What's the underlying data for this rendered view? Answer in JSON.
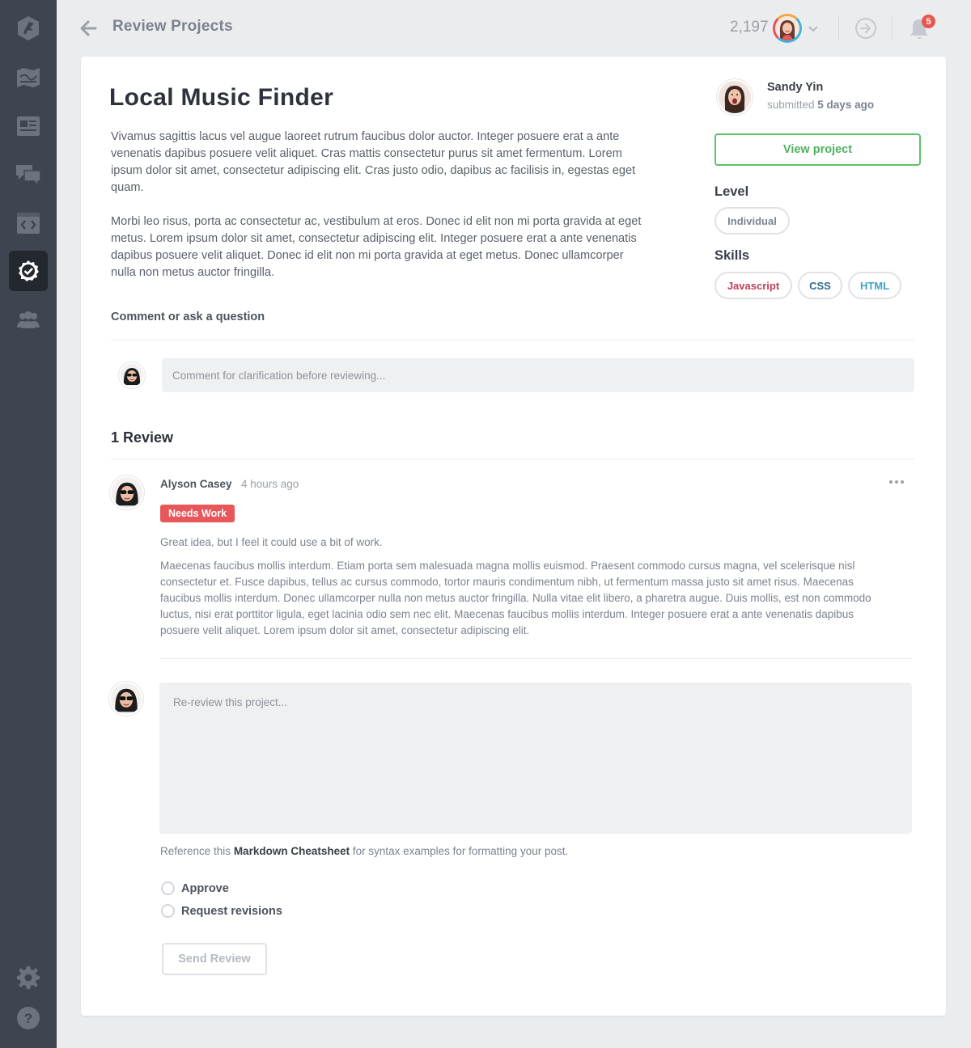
{
  "header": {
    "title": "Review Projects",
    "points": "2,197",
    "notification_count": "5"
  },
  "sidebar": {
    "items": [
      {
        "icon": "logo-icon"
      },
      {
        "icon": "map-icon"
      },
      {
        "icon": "news-icon"
      },
      {
        "icon": "chat-icon"
      },
      {
        "icon": "code-window-icon"
      },
      {
        "icon": "review-check-icon",
        "active": true
      },
      {
        "icon": "community-icon"
      }
    ],
    "bottom": [
      {
        "icon": "gear-icon"
      },
      {
        "icon": "help-icon"
      }
    ]
  },
  "project": {
    "title": "Local Music Finder",
    "description": [
      "Vivamus sagittis lacus vel augue laoreet rutrum faucibus dolor auctor. Integer posuere erat a ante venenatis dapibus posuere velit aliquet. Cras mattis consectetur purus sit amet fermentum. Lorem ipsum dolor sit amet, consectetur adipiscing elit. Cras justo odio, dapibus ac facilisis in, egestas eget quam.",
      "Morbi leo risus, porta ac consectetur ac, vestibulum at eros. Donec id elit non mi porta gravida at eget metus. Lorem ipsum dolor sit amet, consectetur adipiscing elit. Integer posuere erat a ante venenatis dapibus posuere velit aliquet. Donec id elit non mi porta gravida at eget metus. Donec ullamcorper nulla non metus auctor fringilla."
    ],
    "submitter": {
      "name": "Sandy Yin",
      "submitted_prefix": "submitted",
      "submitted_when": "5 days ago"
    },
    "view_button": "View project",
    "level_heading": "Level",
    "level": "Individual",
    "skills_heading": "Skills",
    "skills": [
      {
        "label": "Javascript",
        "color": "#c0405a"
      },
      {
        "label": "CSS",
        "color": "#2e6a92"
      },
      {
        "label": "HTML",
        "color": "#3fa3c8"
      }
    ]
  },
  "comment": {
    "label": "Comment or ask a question",
    "placeholder": "Comment for clarification before reviewing..."
  },
  "reviews": {
    "heading": "1 Review",
    "items": [
      {
        "author": "Alyson Casey",
        "time": "4 hours ago",
        "status": "Needs Work",
        "status_color": "#e8575a",
        "summary": "Great idea, but I feel it could use a bit of work.",
        "body": "Maecenas faucibus mollis interdum. Etiam porta sem malesuada magna mollis euismod. Praesent commodo cursus magna, vel scelerisque nisl consectetur et. Fusce dapibus, tellus ac cursus commodo, tortor mauris condimentum nibh, ut fermentum massa justo sit amet risus. Maecenas faucibus mollis interdum. Donec ullamcorper nulla non metus auctor fringilla. Nulla vitae elit libero, a pharetra augue. Duis mollis, est non commodo luctus, nisi erat porttitor ligula, eget lacinia odio sem nec elit. Maecenas faucibus mollis interdum. Integer posuere erat a ante venenatis dapibus posuere velit aliquet. Lorem ipsum dolor sit amet, consectetur adipiscing elit."
      }
    ]
  },
  "rereview": {
    "placeholder": "Re-review this project...",
    "md_prefix": "Reference this",
    "md_link": "Markdown Cheatsheet",
    "md_suffix": "for syntax examples for formatting your post.",
    "options": [
      "Approve",
      "Request revisions"
    ],
    "send_button": "Send Review"
  },
  "colors": {
    "sidebar_bg": "#3e4550",
    "accent_green": "#5cc46b",
    "needs_work": "#e8575a",
    "notification": "#e8574e"
  }
}
